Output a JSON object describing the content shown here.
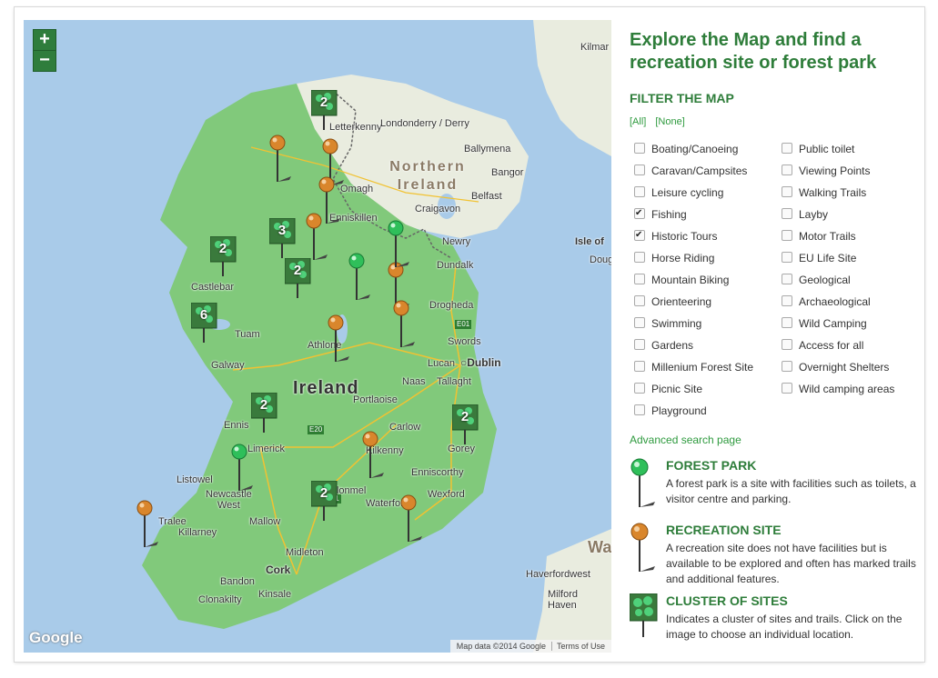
{
  "map": {
    "zoom_in": "+",
    "zoom_out": "−",
    "places": {
      "kilmarnock": "Kilmar",
      "letterkenny": "Letterkenny",
      "derry": "Londonderry / Derry",
      "ballymena": "Ballymena",
      "northern_ireland": "Northern Ireland",
      "bangor": "Bangor",
      "omagh": "Omagh",
      "belfast": "Belfast",
      "enniskillen": "Enniskillen",
      "craigavon": "Craigavon",
      "newry": "Newry",
      "isle_of_man": "Isle of",
      "douglas": "Doug",
      "dundalk": "Dundalk",
      "castlebar": "Castlebar",
      "drogheda": "Drogheda",
      "tuam": "Tuam",
      "athlone": "Athlone",
      "swords": "Swords",
      "galway": "Galway",
      "lucan": "Lucan",
      "dublin": "Dublin",
      "naas": "Naas",
      "tallaght": "Tallaght",
      "ireland": "Ireland",
      "portlaoise": "Portlaoise",
      "ennis": "Ennis",
      "carlow": "Carlow",
      "limerick": "Limerick",
      "kilkenny": "Kilkenny",
      "gorey": "Gorey",
      "listowel": "Listowel",
      "enniscorthy": "Enniscorthy",
      "newcastle_west": "Newcastle\nWest",
      "clonmel": "Clonmel",
      "tralee": "Tralee",
      "waterford": "Waterford",
      "wexford": "Wexford",
      "killarney": "Killarney",
      "mallow": "Mallow",
      "middleton": "Midleton",
      "cork": "Cork",
      "bandon": "Bandon",
      "kinsale": "Kinsale",
      "clonakilty": "Clonakilty",
      "haverfordwest": "Haverfordwest",
      "milford_haven": "Milford\nHaven",
      "wales": "Wa"
    },
    "roads": [
      "E01",
      "E20",
      "E201"
    ],
    "google_logo": "Google",
    "attribution": "Map data ©2014 Google",
    "terms": "Terms of Use",
    "clusters": [
      "2",
      "3",
      "2",
      "2",
      "6",
      "2",
      "2",
      "2"
    ]
  },
  "panel": {
    "heading": "Explore the Map and find a recreation site or forest park",
    "filter_title": "FILTER THE MAP",
    "all": "[All]",
    "none": "[None]",
    "filters_left": [
      {
        "label": "Boating/Canoeing",
        "checked": false
      },
      {
        "label": "Caravan/Campsites",
        "checked": false
      },
      {
        "label": "Leisure cycling",
        "checked": false
      },
      {
        "label": "Fishing",
        "checked": true
      },
      {
        "label": "Historic Tours",
        "checked": true
      },
      {
        "label": "Horse Riding",
        "checked": false
      },
      {
        "label": "Mountain Biking",
        "checked": false
      },
      {
        "label": "Orienteering",
        "checked": false
      },
      {
        "label": "Swimming",
        "checked": false
      },
      {
        "label": "Gardens",
        "checked": false
      },
      {
        "label": "Millenium Forest Site",
        "checked": false
      },
      {
        "label": "Picnic Site",
        "checked": false
      },
      {
        "label": "Playground",
        "checked": false
      }
    ],
    "filters_right": [
      {
        "label": "Public toilet",
        "checked": false
      },
      {
        "label": "Viewing Points",
        "checked": false
      },
      {
        "label": "Walking Trails",
        "checked": false
      },
      {
        "label": "Layby",
        "checked": false
      },
      {
        "label": "Motor Trails",
        "checked": false
      },
      {
        "label": "EU Life Site",
        "checked": false
      },
      {
        "label": "Geological",
        "checked": false
      },
      {
        "label": "Archaeological",
        "checked": false
      },
      {
        "label": "Wild Camping",
        "checked": false
      },
      {
        "label": "Access for all",
        "checked": false
      },
      {
        "label": "Overnight Shelters",
        "checked": false
      },
      {
        "label": "Wild camping areas",
        "checked": false
      }
    ],
    "advanced_link": "Advanced search page",
    "legend": [
      {
        "title": "FOREST PARK",
        "desc": "A forest park is a site with facilities such as toilets, a visitor centre and parking.",
        "icon": "green-pin-icon"
      },
      {
        "title": "RECREATION SITE",
        "desc": "A recreation site does not have facilities but is available to be explored and often has marked trails and additional features.",
        "icon": "orange-pin-icon"
      },
      {
        "title": "CLUSTER OF SITES",
        "desc": "Indicates a cluster of sites and trails. Click on the image to choose an individual location.",
        "icon": "cluster-icon"
      }
    ]
  },
  "colors": {
    "brand_green": "#2e7d3a",
    "link_green": "#2e9a3e",
    "land": "#7fcb7b",
    "sea": "#a9cbe9",
    "forest_pin": "#2fbf5a",
    "recreation_pin": "#d9862c"
  }
}
